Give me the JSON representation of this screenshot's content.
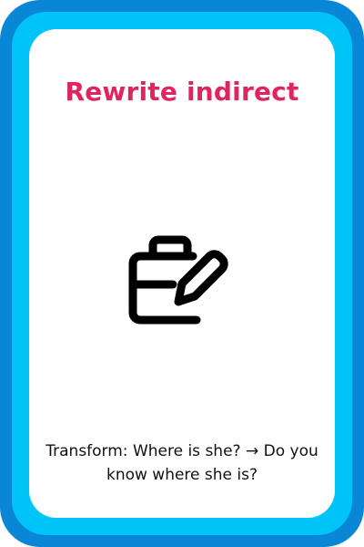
{
  "card": {
    "title": "Rewrite indirect",
    "icon": "briefcase-pencil-icon",
    "prompt": "Transform: Where is she? → Do you know where she is?"
  },
  "colors": {
    "outer_frame": "#0a86d6",
    "inner_ring": "#00c4f7",
    "face": "#ffffff",
    "title": "#e0245e",
    "text": "#111111"
  }
}
